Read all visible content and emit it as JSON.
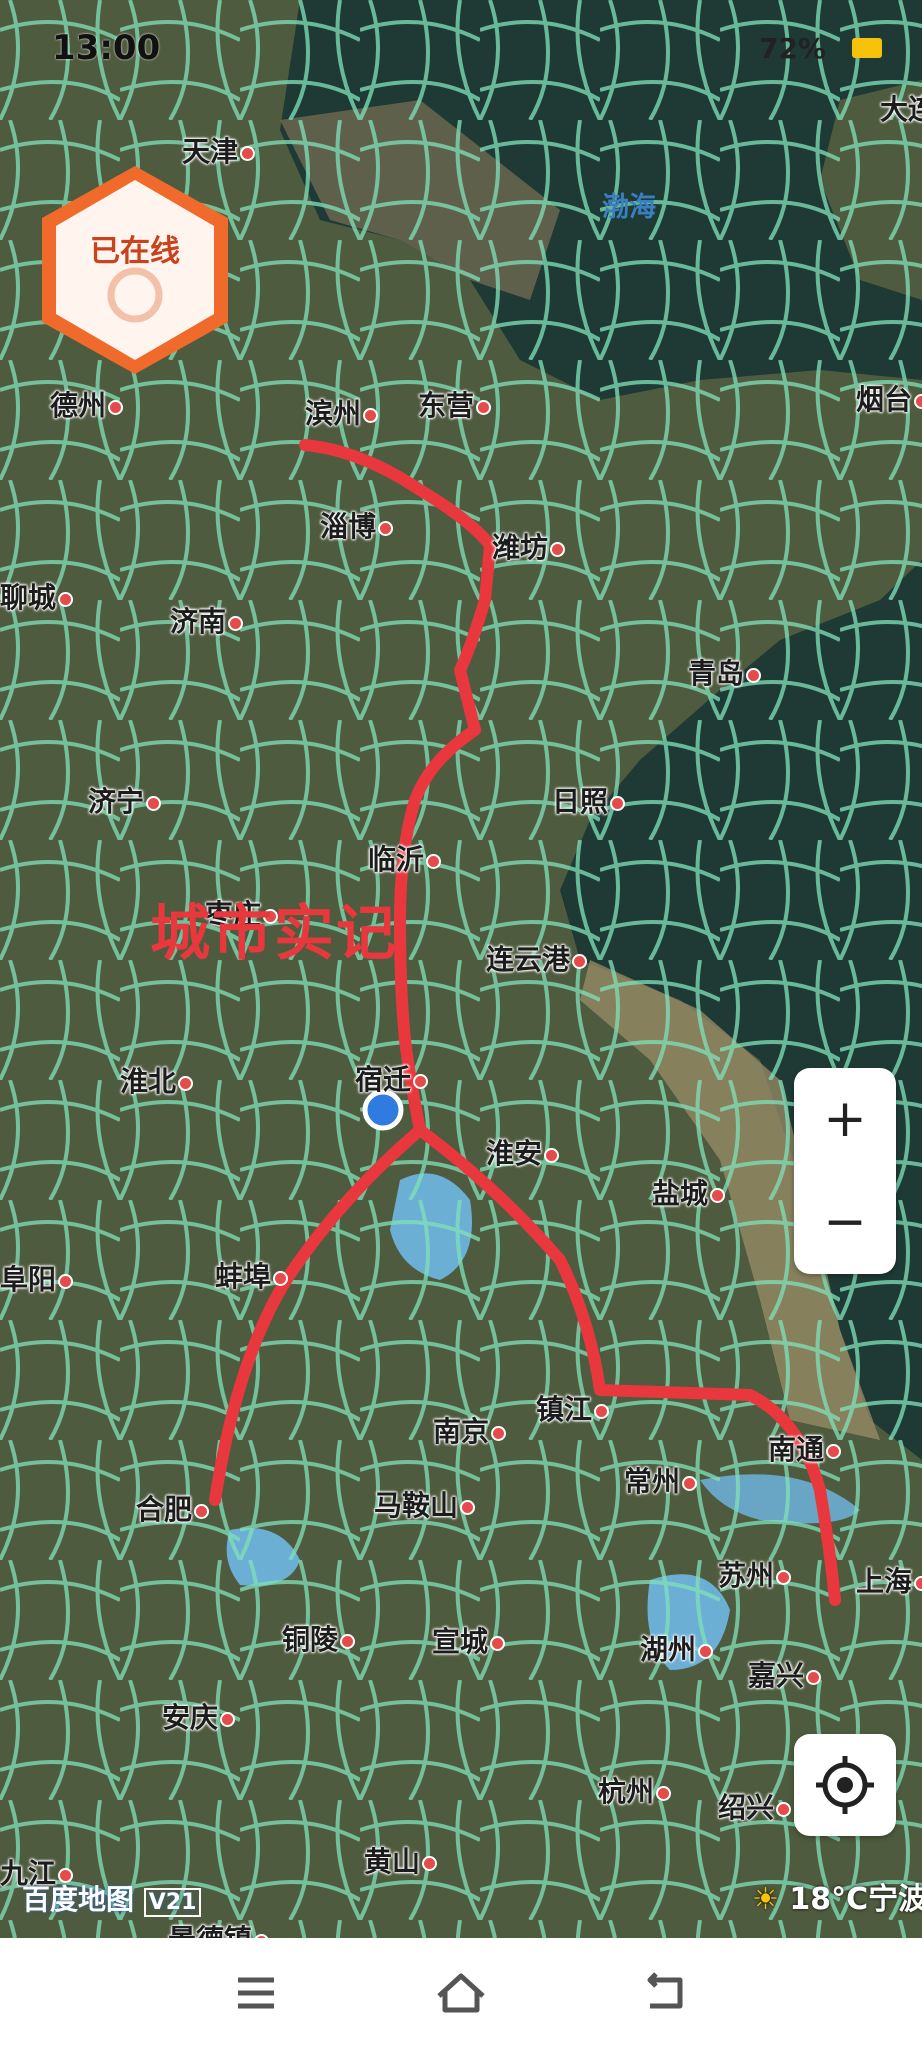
{
  "status_bar": {
    "time": "13:00",
    "right_text": "72%",
    "battery_color": "#f7c20a"
  },
  "badge": {
    "label": "已在线"
  },
  "watermark": "城市实记",
  "water_labels": [
    {
      "id": "bohai",
      "name": "渤海"
    }
  ],
  "cities": {
    "tianjin": "天津",
    "dalian": "大连",
    "dezhou": "德州",
    "binzhou": "滨州",
    "dongying": "东营",
    "yantai": "烟台",
    "zibo": "淄博",
    "weifang": "潍坊",
    "liaocheng": "聊城",
    "jinan": "济南",
    "qingdao": "青岛",
    "jining": "济宁",
    "rizhao": "日照",
    "linyi": "临沂",
    "zaozhuang": "枣庄",
    "lianyungang": "连云港",
    "huaibei": "淮北",
    "suqian": "宿迁",
    "huaian": "淮安",
    "yancheng": "盐城",
    "bengbu": "蚌埠",
    "fuyang": "阜阳",
    "nanjing": "南京",
    "zhenjiang": "镇江",
    "nantong": "南通",
    "changzhou": "常州",
    "hefei": "合肥",
    "maanshan": "马鞍山",
    "suzhou": "苏州",
    "shanghai": "上海",
    "tongling": "铜陵",
    "xuancheng": "宣城",
    "huzhou": "湖州",
    "jiaxing": "嘉兴",
    "anqing": "安庆",
    "hangzhou": "杭州",
    "shaoxing": "绍兴",
    "huangshan": "黄山",
    "jiujiang": "九江",
    "jingdezhen": "景德镇"
  },
  "map_attribution": "百度地图",
  "map_version": "V21",
  "weather": {
    "temp": "18°C",
    "location": "宁波"
  },
  "zoom": {
    "in": "+",
    "out": "−"
  },
  "colors": {
    "route": "#e8383d",
    "roads": "#7fe0b8",
    "land": "#4b5a3e",
    "sea": "#1f3a35",
    "lake": "#6fb8e6"
  },
  "icons": [
    "menu-icon",
    "home-icon",
    "back-icon",
    "locate-icon",
    "location-pin-icon",
    "sun-icon"
  ]
}
